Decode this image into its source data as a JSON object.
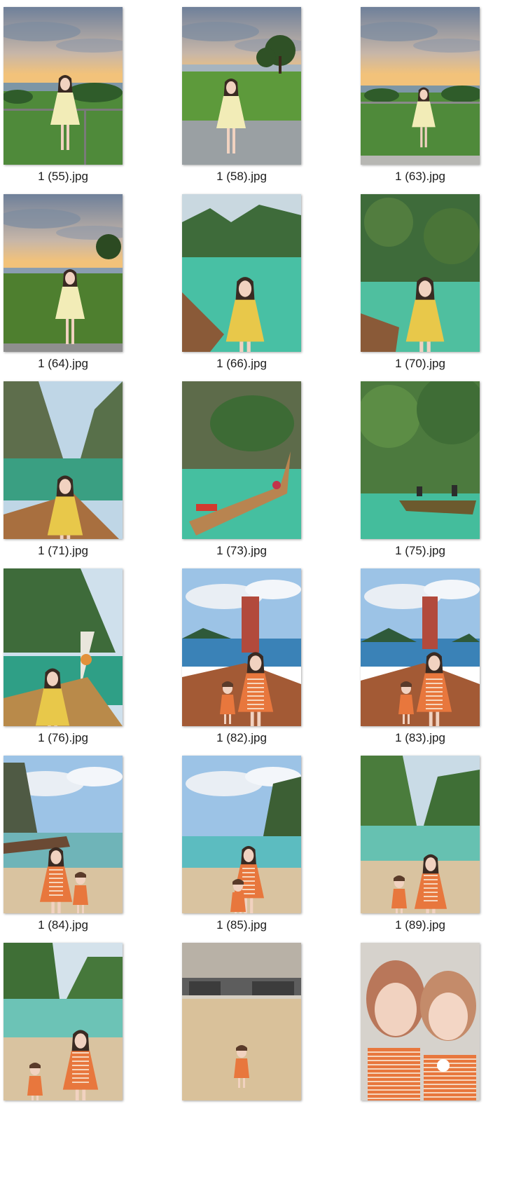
{
  "window": {
    "title": ""
  },
  "files": [
    {
      "name": "1 (55).jpg",
      "scene": "sunset-railing"
    },
    {
      "name": "1 (58).jpg",
      "scene": "sunset-tree"
    },
    {
      "name": "1 (63).jpg",
      "scene": "sunset-railing-far"
    },
    {
      "name": "1 (64).jpg",
      "scene": "sunset-grass"
    },
    {
      "name": "1 (66).jpg",
      "scene": "lagoon-selfie"
    },
    {
      "name": "1 (70).jpg",
      "scene": "lagoon-boat-sit"
    },
    {
      "name": "1 (71).jpg",
      "scene": "canyon-boat"
    },
    {
      "name": "1 (73).jpg",
      "scene": "cliff-boat-people"
    },
    {
      "name": "1 (75).jpg",
      "scene": "cliff-boat-far"
    },
    {
      "name": "1 (76).jpg",
      "scene": "boat-bow-sit"
    },
    {
      "name": "1 (82).jpg",
      "scene": "mother-child-boat"
    },
    {
      "name": "1 (83).jpg",
      "scene": "mother-child-boat-2"
    },
    {
      "name": "1 (84).jpg",
      "scene": "beach-walk"
    },
    {
      "name": "1 (85).jpg",
      "scene": "beach-rock"
    },
    {
      "name": "1 (89).jpg",
      "scene": "beach-cliffs"
    },
    {
      "name": "",
      "scene": "beach-cliffs-2"
    },
    {
      "name": "",
      "scene": "kid-sand"
    },
    {
      "name": "",
      "scene": "closeup-selfie"
    }
  ],
  "colors": {
    "sky_sunset": "#8a9bb0",
    "sunset_glow": "#f2c27a",
    "sea_turquoise": "#3fb69a",
    "cliff_green": "#3e6b3a",
    "sand": "#d9c3a0",
    "boat_wood": "#8a5a38",
    "dress_yellow": "#e8c84a",
    "dress_orange": "#e8773d"
  }
}
